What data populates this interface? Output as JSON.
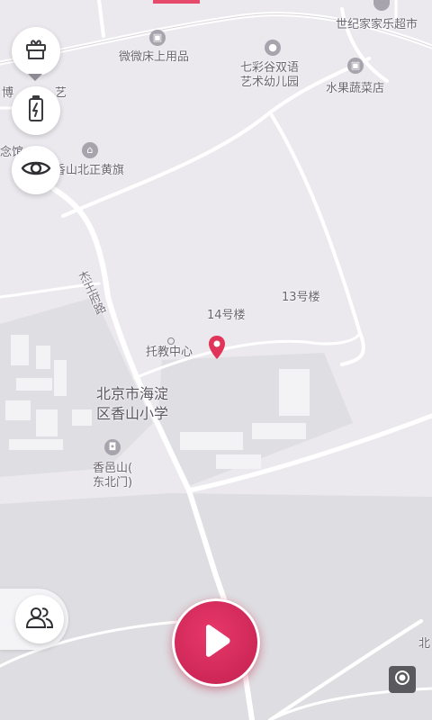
{
  "map": {
    "labels": {
      "supermarket": "世纪家家乐超市",
      "bedding": "微微床上用品",
      "kindergarten_line1": "七彩谷双语",
      "kindergarten_line2": "艺术幼儿园",
      "fruit_shop": "水果蔬菜店",
      "partial_left": "博",
      "partial_left2": "艺",
      "partial_memorial": "念馆",
      "partial_flag": "香山北正黄旗",
      "road_name": "杰王府路",
      "building_14": "14号楼",
      "building_13": "13号楼",
      "childcare": "托教中心",
      "school_line1": "北京市海淀",
      "school_line2": "区香山小学",
      "bus_stop_line1": "香邑山(",
      "bus_stop_line2": "东北门)",
      "partial_right": "北"
    },
    "marker_color": "#e0345a"
  },
  "controls": {
    "gift_icon": "gift-icon",
    "battery_icon": "battery-icon",
    "eye_icon": "eye-icon",
    "users_icon": "users-icon",
    "play_icon": "play-icon",
    "locate_icon": "locate-icon",
    "accent": "#d82a5a"
  }
}
